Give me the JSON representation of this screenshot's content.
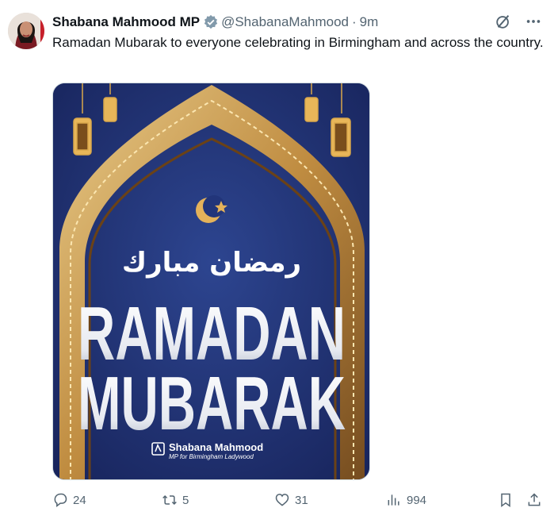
{
  "tweet": {
    "author_name": "Shabana Mahmood MP",
    "handle": "@ShabanaMahmood",
    "separator": "·",
    "time": "9m",
    "text": "Ramadan Mubarak to everyone celebrating in Birmingham and across the country."
  },
  "media": {
    "arabic": "رمضان مبارك",
    "line1": "RAMADAN",
    "line2": "MUBARAK",
    "brand_name": "Shabana Mahmood",
    "brand_sub": "MP for Birmingham Ladywood"
  },
  "actions": {
    "replies": "24",
    "reposts": "5",
    "likes": "31",
    "views": "994"
  },
  "colors": {
    "accent": "#1d9bf0",
    "text": "#0f1419",
    "muted": "#536471",
    "poster_bg": "#1f2f6a",
    "gold": "#d9a74a"
  }
}
